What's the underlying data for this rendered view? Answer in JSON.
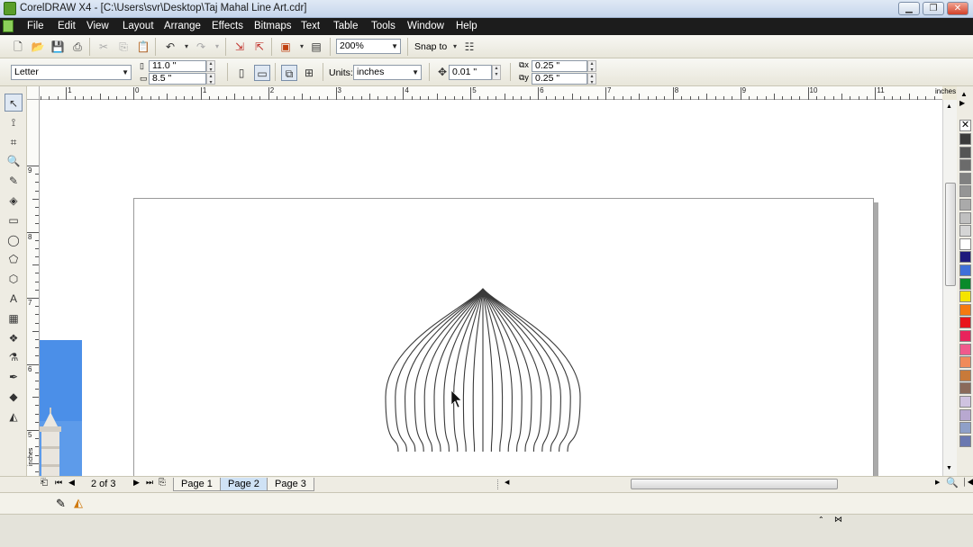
{
  "window": {
    "title": "CorelDRAW X4 - [C:\\Users\\svr\\Desktop\\Taj Mahal Line Art.cdr]",
    "controls": [
      "minimize",
      "restore",
      "close"
    ]
  },
  "menu": [
    "File",
    "Edit",
    "View",
    "Layout",
    "Arrange",
    "Effects",
    "Bitmaps",
    "Text",
    "Table",
    "Tools",
    "Window",
    "Help"
  ],
  "standard_toolbar": {
    "zoom": "200%",
    "snap_to": "Snap to"
  },
  "property_bar": {
    "paper": "Letter",
    "width": "11.0 \"",
    "height": "8.5 \"",
    "units_label": "Units:",
    "units": "inches",
    "nudge": "0.01 \"",
    "dup_x": "0.25 \"",
    "dup_y": "0.25 \""
  },
  "ruler": {
    "unit": "inches",
    "top_ticks": [
      "1",
      "0",
      "1",
      "2",
      "3",
      "4",
      "5",
      "6",
      "7",
      "8",
      "9",
      "10",
      "11"
    ],
    "left_ticks": [
      "9",
      "8",
      "7",
      "6",
      "5"
    ],
    "left_unit": "inches"
  },
  "pages": {
    "counter": "2 of 3",
    "tabs": [
      "Page 1",
      "Page 2",
      "Page 3"
    ],
    "active": 1
  },
  "palette_colors": [
    "#3b3b3b",
    "#555555",
    "#6b6b6b",
    "#808080",
    "#959595",
    "#aaaaaa",
    "#c0c0c0",
    "#d5d5d5",
    "#ffffff",
    "#1f1a7c",
    "#3f6fd8",
    "#0a8a2a",
    "#f5e400",
    "#f57a10",
    "#e8141a",
    "#e8235c",
    "#f05a8c",
    "#f08a5a",
    "#c87a3a",
    "#8a6a5a",
    "#cfc3e0",
    "#b8a8d0",
    "#8fa0c8",
    "#6a78b0"
  ],
  "tools": [
    "pick-tool",
    "shape-tool",
    "crop-tool",
    "zoom-tool",
    "freehand-tool",
    "smart-fill-tool",
    "rectangle-tool",
    "ellipse-tool",
    "polygon-tool",
    "basic-shapes-tool",
    "text-tool",
    "table-tool",
    "interactive-blend-tool",
    "eyedropper-tool",
    "outline-tool",
    "fill-tool",
    "interactive-fill-tool"
  ],
  "tool_glyphs": [
    "↖",
    "⟟",
    "⌗",
    "🔍",
    "✎",
    "◈",
    "▭",
    "◯",
    "⬠",
    "⬡",
    "A",
    "▦",
    "❖",
    "⚗",
    "✒",
    "◆",
    "◭"
  ]
}
